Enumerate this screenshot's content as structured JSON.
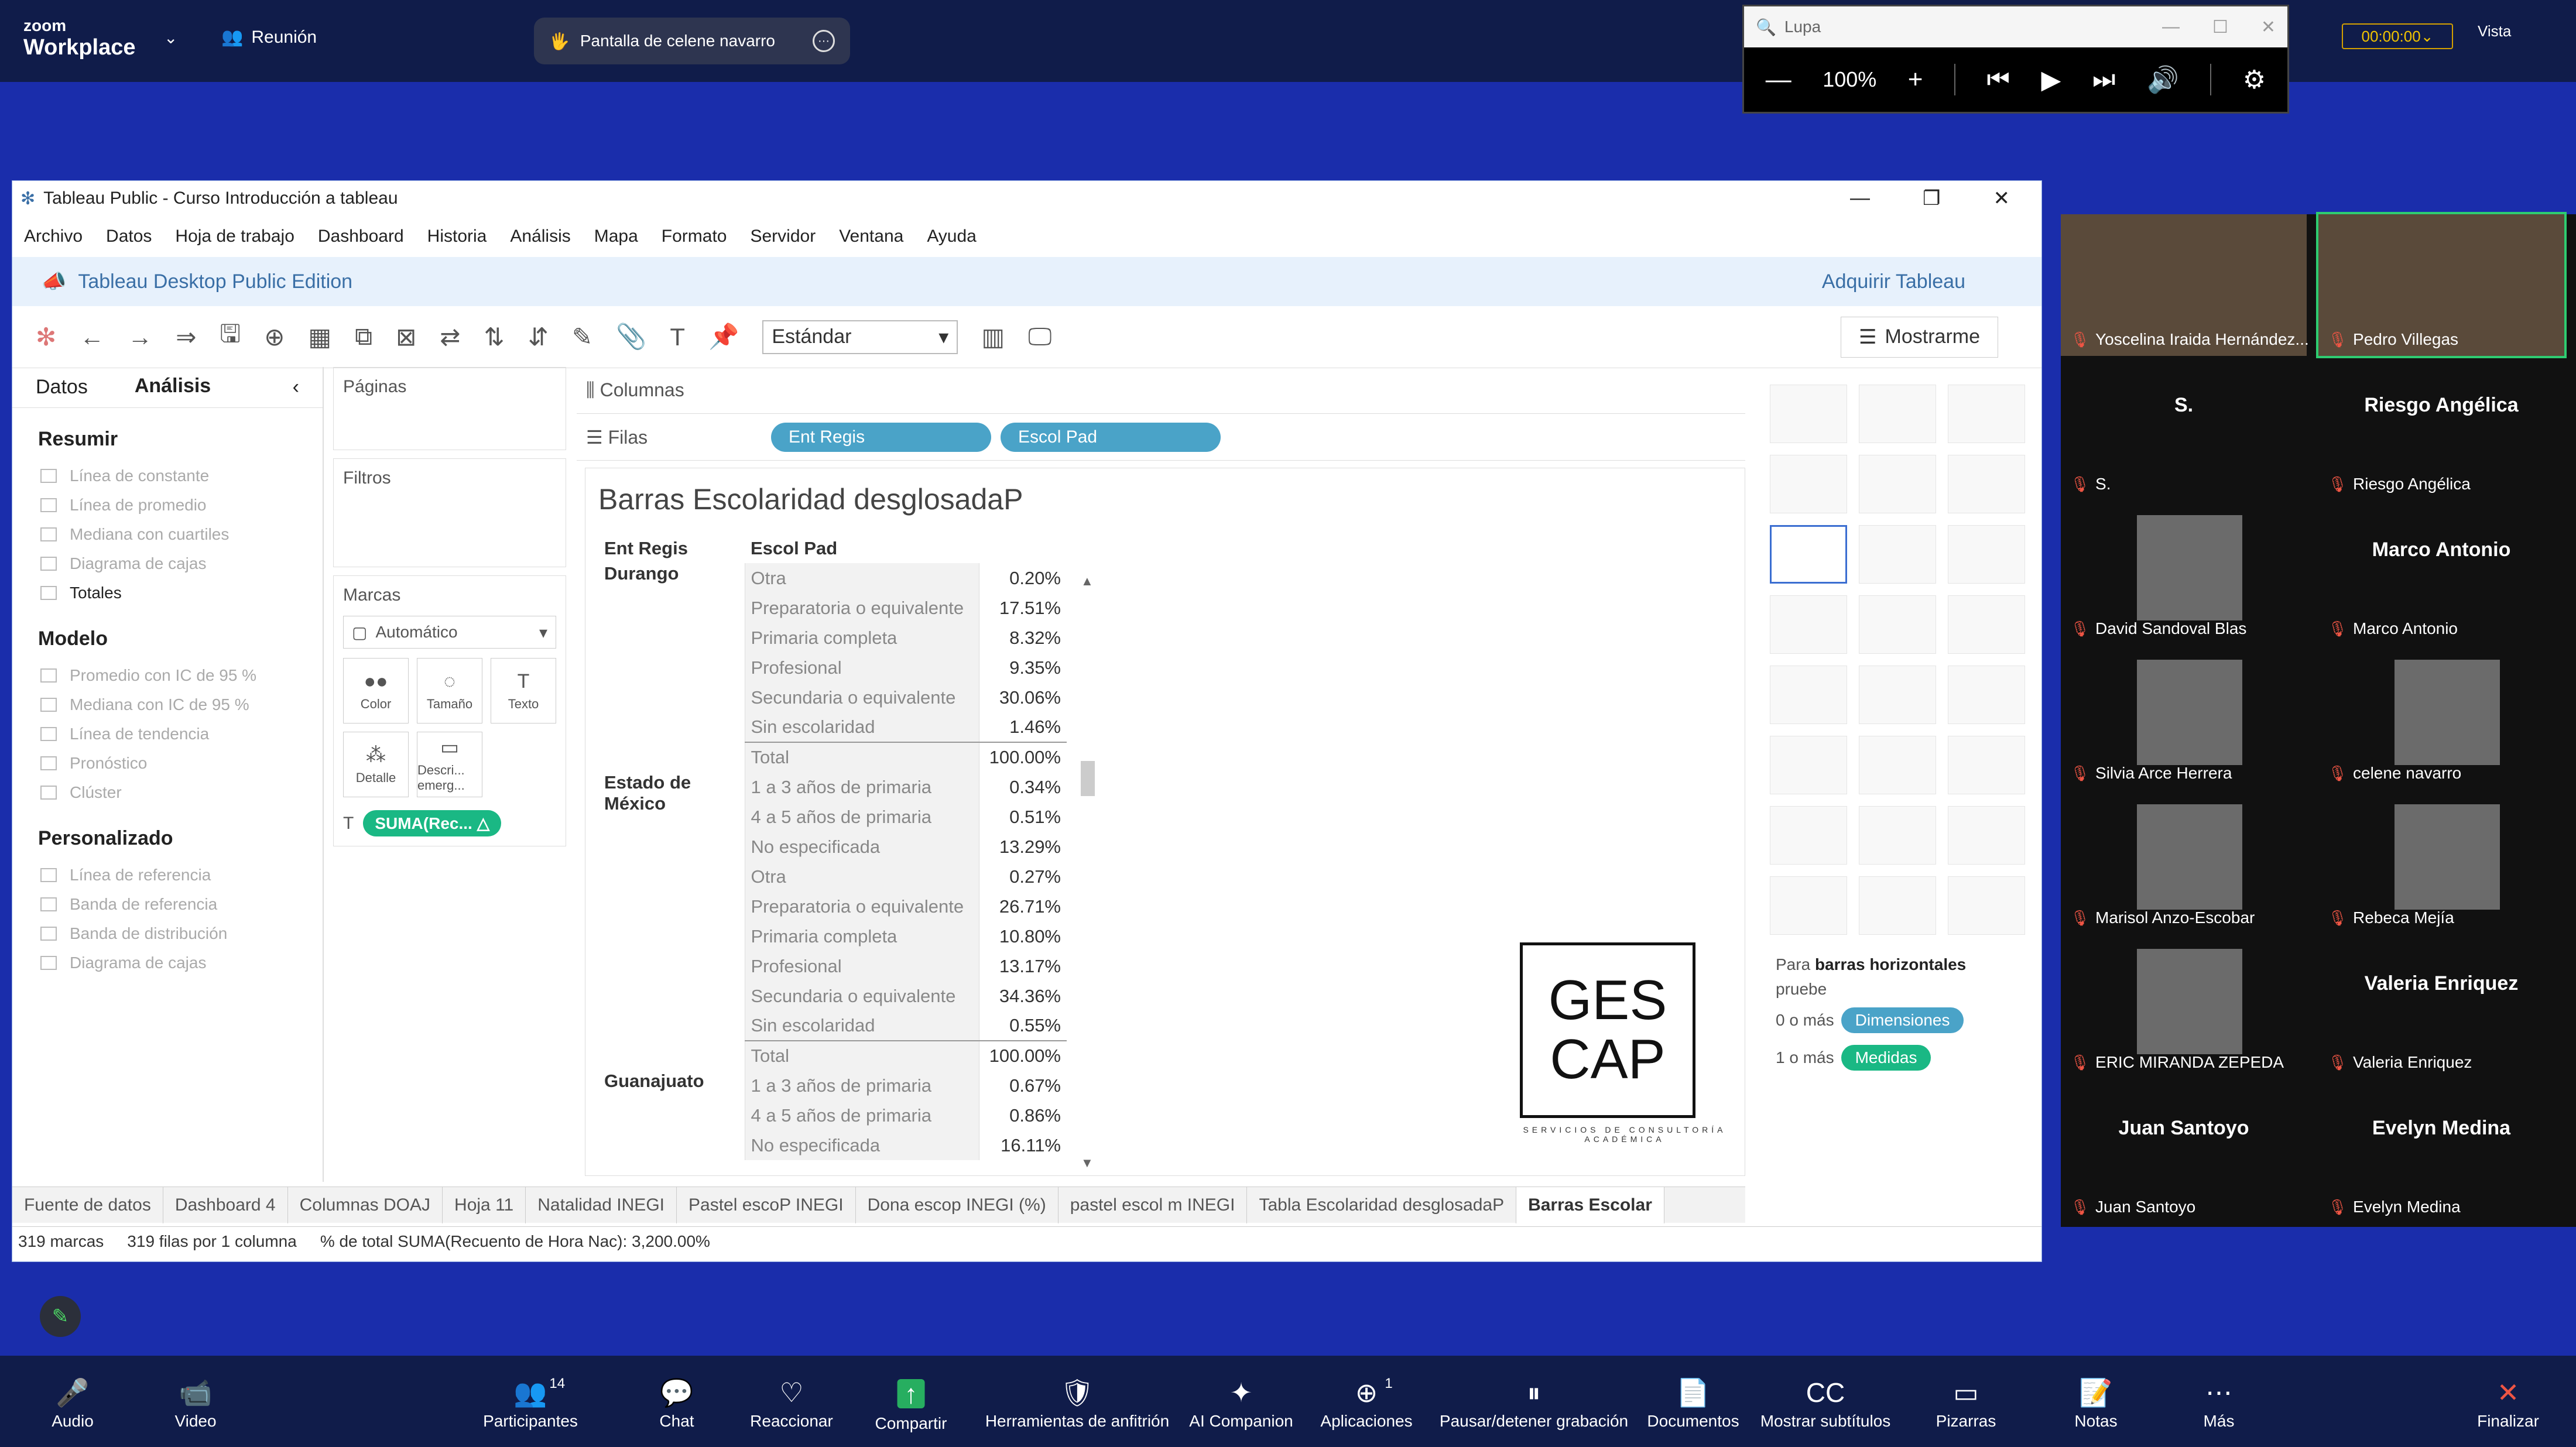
{
  "zoom": {
    "brand_small": "zoom",
    "brand": "Workplace",
    "meeting": "Reunión",
    "share_label": "Pantalla de celene navarro",
    "timer": "00:00:00",
    "view": "Vista"
  },
  "lupa": {
    "title": "Lupa",
    "zoom": "100%"
  },
  "tableau": {
    "title": "Tableau Public - Curso Introducción a tableau",
    "menu": [
      "Archivo",
      "Datos",
      "Hoja de trabajo",
      "Dashboard",
      "Historia",
      "Análisis",
      "Mapa",
      "Formato",
      "Servidor",
      "Ventana",
      "Ayuda"
    ],
    "edition": "Tableau Desktop Public Edition",
    "acquire": "Adquirir Tableau",
    "fit": "Estándar",
    "show_me": "Mostrarme",
    "tabs": [
      "Datos",
      "Análisis"
    ],
    "sections": [
      {
        "title": "Resumir",
        "items": [
          "Línea de constante",
          "Línea de promedio",
          "Mediana con cuartiles",
          "Diagrama de cajas",
          "Totales"
        ]
      },
      {
        "title": "Modelo",
        "items": [
          "Promedio con IC de 95 %",
          "Mediana con IC de 95 %",
          "Línea de tendencia",
          "Pronóstico",
          "Clúster"
        ]
      },
      {
        "title": "Personalizado",
        "items": [
          "Línea de referencia",
          "Banda de referencia",
          "Banda de distribución",
          "Diagrama de cajas"
        ]
      }
    ],
    "cards": {
      "pages": "Páginas",
      "filters": "Filtros",
      "marks": "Marcas",
      "mark_type": "Automático",
      "mark_buttons": [
        "Color",
        "Tamaño",
        "Texto",
        "Detalle",
        "Descri... emerg..."
      ],
      "pill": "SUMA(Rec...  △"
    },
    "shelves": {
      "columns": "Columnas",
      "rows": "Filas",
      "rows_pills": [
        "Ent Regis",
        "Escol Pad"
      ]
    },
    "view": {
      "title": "Barras Escolaridad desglosadaP",
      "headers": [
        "Ent Regis",
        "Escol Pad",
        ""
      ],
      "groups": [
        {
          "region": "Durango",
          "rows": [
            [
              "Otra",
              "0.20%"
            ],
            [
              "Preparatoria o equivalente",
              "17.51%"
            ],
            [
              "Primaria completa",
              "8.32%"
            ],
            [
              "Profesional",
              "9.35%"
            ],
            [
              "Secundaria o equivalente",
              "30.06%"
            ],
            [
              "Sin escolaridad",
              "1.46%"
            ],
            [
              "Total",
              "100.00%"
            ]
          ]
        },
        {
          "region": "Estado de México",
          "rows": [
            [
              "1 a 3 años de primaria",
              "0.34%"
            ],
            [
              "4 a 5 años de primaria",
              "0.51%"
            ],
            [
              "No especificada",
              "13.29%"
            ],
            [
              "Otra",
              "0.27%"
            ],
            [
              "Preparatoria o equivalente",
              "26.71%"
            ],
            [
              "Primaria completa",
              "10.80%"
            ],
            [
              "Profesional",
              "13.17%"
            ],
            [
              "Secundaria o equivalente",
              "34.36%"
            ],
            [
              "Sin escolaridad",
              "0.55%"
            ],
            [
              "Total",
              "100.00%"
            ]
          ]
        },
        {
          "region": "Guanajuato",
          "rows": [
            [
              "1 a 3 años de primaria",
              "0.67%"
            ],
            [
              "4 a 5 años de primaria",
              "0.86%"
            ],
            [
              "No especificada",
              "16.11%"
            ]
          ]
        }
      ],
      "logo_l1": "GES",
      "logo_l2": "CAP",
      "logo_sub": "SERVICIOS DE CONSULTORÍA ACADÉMICA"
    },
    "show_me_hint_pre": "Para ",
    "show_me_hint_b": "barras horizontales",
    "show_me_hint_post": " pruebe",
    "dims_pre": "0 o más",
    "dims": "Dimensiones",
    "meas_pre": "1 o más",
    "meas": "Medidas",
    "sheets": [
      "Fuente de datos",
      "Dashboard 4",
      "Columnas DOAJ",
      "Hoja 11",
      "Natalidad INEGI",
      "Pastel escoP INEGI",
      "Dona escop INEGI (%)",
      "pastel escol m INEGI",
      "Tabla Escolaridad desglosadaP",
      "Barras Escolar"
    ],
    "status": [
      "319 marcas",
      "319 filas  por  1 columna",
      "% de total SUMA(Recuento de Hora Nac): 3,200.00%"
    ]
  },
  "participants": [
    {
      "name": "Yoscelina Iraida Hernández...",
      "photo": true
    },
    {
      "name": "Pedro Villegas",
      "photo": true,
      "selected": true
    },
    {
      "name": "S.",
      "big": "S."
    },
    {
      "name": "Riesgo Angélica",
      "big": "Riesgo Angélica"
    },
    {
      "name": "David Sandoval Blas",
      "photo": true
    },
    {
      "name": "Marco Antonio",
      "big": "Marco Antonio"
    },
    {
      "name": "Silvia Arce Herrera",
      "photo": true
    },
    {
      "name": "celene navarro",
      "photo": true
    },
    {
      "name": "Marisol Anzo-Escobar",
      "photo": true
    },
    {
      "name": "Rebeca Mejía",
      "photo": true
    },
    {
      "name": "ERIC  MIRANDA ZEPEDA",
      "photo": true
    },
    {
      "name": "Valeria Enriquez",
      "big": "Valeria Enriquez"
    },
    {
      "name": "Juan Santoyo",
      "big": "Juan Santoyo"
    },
    {
      "name": "Evelyn Medina",
      "big": "Evelyn Medina"
    }
  ],
  "bottom": [
    {
      "label": "Audio",
      "icon": "🎤"
    },
    {
      "label": "Video",
      "icon": "📹"
    },
    {
      "label": "Participantes",
      "icon": "👥",
      "count": "14"
    },
    {
      "label": "Chat",
      "icon": "💬"
    },
    {
      "label": "Reaccionar",
      "icon": "♡"
    },
    {
      "label": "Compartir",
      "icon": "↑"
    },
    {
      "label": "Herramientas de anfitrión",
      "icon": "🛡"
    },
    {
      "label": "AI Companion",
      "icon": "✦"
    },
    {
      "label": "Aplicaciones",
      "icon": "⊕",
      "count": "1"
    },
    {
      "label": "Pausar/detener grabación",
      "icon": "⏸"
    },
    {
      "label": "Documentos",
      "icon": "📄"
    },
    {
      "label": "Mostrar subtítulos",
      "icon": "CC"
    },
    {
      "label": "Pizarras",
      "icon": "▭"
    },
    {
      "label": "Notas",
      "icon": "📝"
    },
    {
      "label": "Más",
      "icon": "⋯"
    },
    {
      "label": "Finalizar",
      "icon": "✕"
    }
  ]
}
